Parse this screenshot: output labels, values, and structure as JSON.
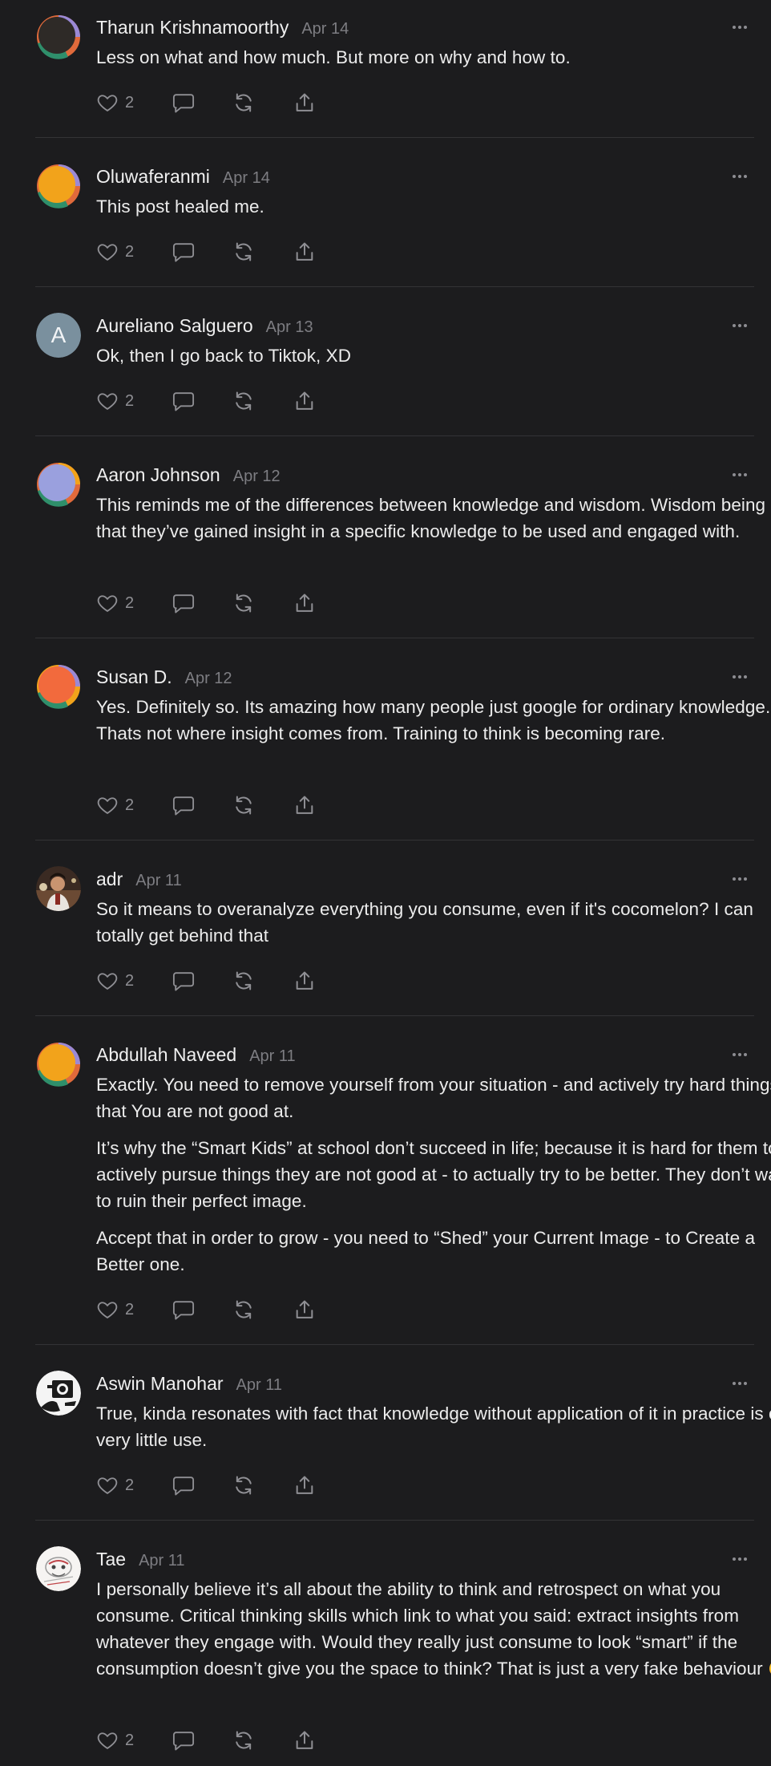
{
  "comments": [
    {
      "author": "Tharun Krishnamoorthy",
      "date": "Apr 14",
      "avatar": {
        "type": "blob",
        "color": "#2e2a27",
        "ring": "tricolor"
      },
      "paragraphs": [
        "Less on what and how much. But more on why and how to."
      ],
      "likes": "2"
    },
    {
      "author": "Oluwaferanmi",
      "date": "Apr 14",
      "avatar": {
        "type": "blob",
        "color": "#f2a31b",
        "ring": "tricolor"
      },
      "paragraphs": [
        "This post healed me."
      ],
      "likes": "2"
    },
    {
      "author": "Aureliano Salguero",
      "date": "Apr 13",
      "avatar": {
        "type": "letter",
        "letter": "A",
        "color": "#7a909e"
      },
      "paragraphs": [
        "Ok, then I go back to Tiktok, XD"
      ],
      "likes": "2"
    },
    {
      "author": "Aaron Johnson",
      "date": "Apr 12",
      "avatar": {
        "type": "blob",
        "color": "#9aa0de",
        "ring": "tricolor"
      },
      "paragraphs": [
        "This reminds me of the differences between knowledge and wisdom. Wisdom being that they’ve gained insight in a specific knowledge to be used and engaged with."
      ],
      "likes": "2"
    },
    {
      "author": "Susan D.",
      "date": "Apr 12",
      "avatar": {
        "type": "blob",
        "color": "#f26a3d",
        "ring": "tricolor"
      },
      "paragraphs": [
        "Yes. Definitely so. Its amazing how many people just google for ordinary knowledge. Thats not where insight comes from. Training to think is becoming rare."
      ],
      "likes": "2"
    },
    {
      "author": "adr",
      "date": "Apr 11",
      "avatar": {
        "type": "photo",
        "icon": "person-photo"
      },
      "paragraphs": [
        "So it means to overanalyze everything you consume, even if it's cocomelon? I can totally get behind that"
      ],
      "likes": "2"
    },
    {
      "author": "Abdullah Naveed",
      "date": "Apr 11",
      "avatar": {
        "type": "blob",
        "color": "#f2a31b",
        "ring": "tricolor"
      },
      "paragraphs": [
        "Exactly. You need to remove yourself from your situation - and actively try hard things that You are not good at.",
        "It’s why the “Smart Kids” at school don’t succeed in life; because it is hard for them to actively pursue things they are not good at - to actually try to be better. They don’t want to ruin their perfect image.",
        "Accept that in order to grow - you need to “Shed” your Current Image - to Create a Better one."
      ],
      "likes": "2"
    },
    {
      "author": "Aswin Manohar",
      "date": "Apr 11",
      "avatar": {
        "type": "photo",
        "icon": "bw-drawing-photo"
      },
      "paragraphs": [
        "True, kinda resonates with fact that knowledge without application of it in practice is of very little use."
      ],
      "likes": "2"
    },
    {
      "author": "Tae",
      "date": "Apr 11",
      "avatar": {
        "type": "photo",
        "icon": "sketch-photo"
      },
      "paragraphs": [
        "I personally believe it’s all about the ability to think and retrospect on what you consume. Critical thinking skills which link to what you said: extract insights from whatever they engage with. Would they really just consume to look “smart” if the consumption doesn’t give you the space to think? That is just a very fake behaviour 🤣"
      ],
      "likes": "2"
    }
  ]
}
